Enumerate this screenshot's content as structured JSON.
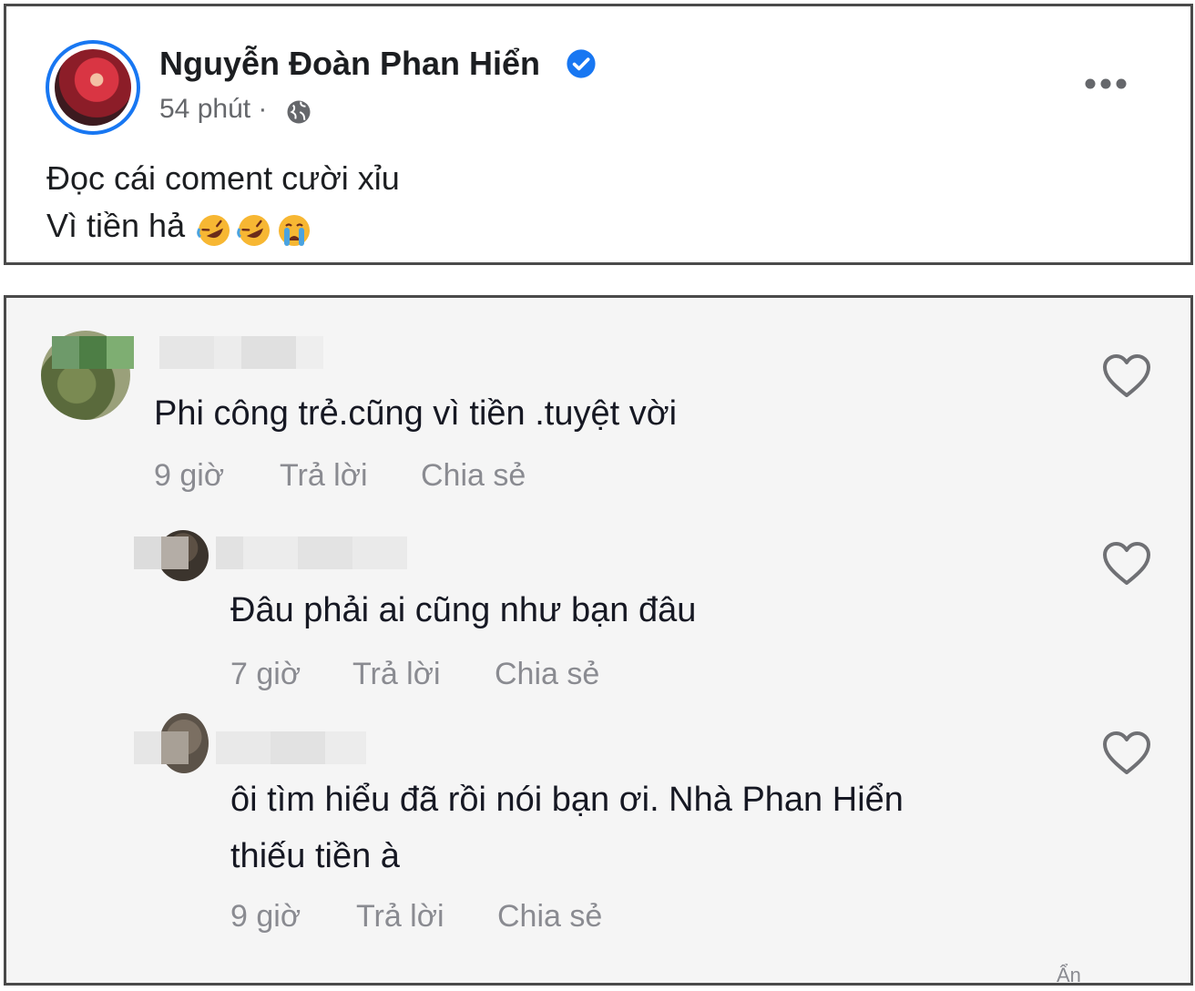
{
  "post": {
    "author": "Nguyễn Đoàn Phan Hiển",
    "time": "54 phút ·",
    "line1": "Đọc cái coment cười xỉu",
    "line2": "Vì tiền hả",
    "icons": {
      "verified": "verified-badge-icon",
      "audience": "globe-icon",
      "more": "more-options-icon",
      "emoji": [
        "rolling-laughing-emoji",
        "rolling-laughing-emoji",
        "crying-emoji"
      ]
    }
  },
  "comments": [
    {
      "text": "Phi công trẻ.cũng vì tiền .tuyệt vời",
      "time": "9 giờ",
      "reply": "Trả lời",
      "share": "Chia sẻ"
    },
    {
      "text": "Đâu phải ai cũng như bạn đâu",
      "time": "7 giờ",
      "reply": "Trả lời",
      "share": "Chia sẻ"
    },
    {
      "text_line1": "ôi tìm hiểu đã rồi nói bạn ơi. Nhà Phan Hiển",
      "text_line2": "thiếu tiền à",
      "time": "9 giờ",
      "reply": "Trả lời",
      "share": "Chia sẻ"
    }
  ],
  "more_hint": "Ẩn",
  "colors": {
    "facebook_blue": "#1877f2",
    "text_dark": "#161823",
    "meta_gray": "#8a8b91",
    "panel_bg": "#f5f5f5"
  }
}
